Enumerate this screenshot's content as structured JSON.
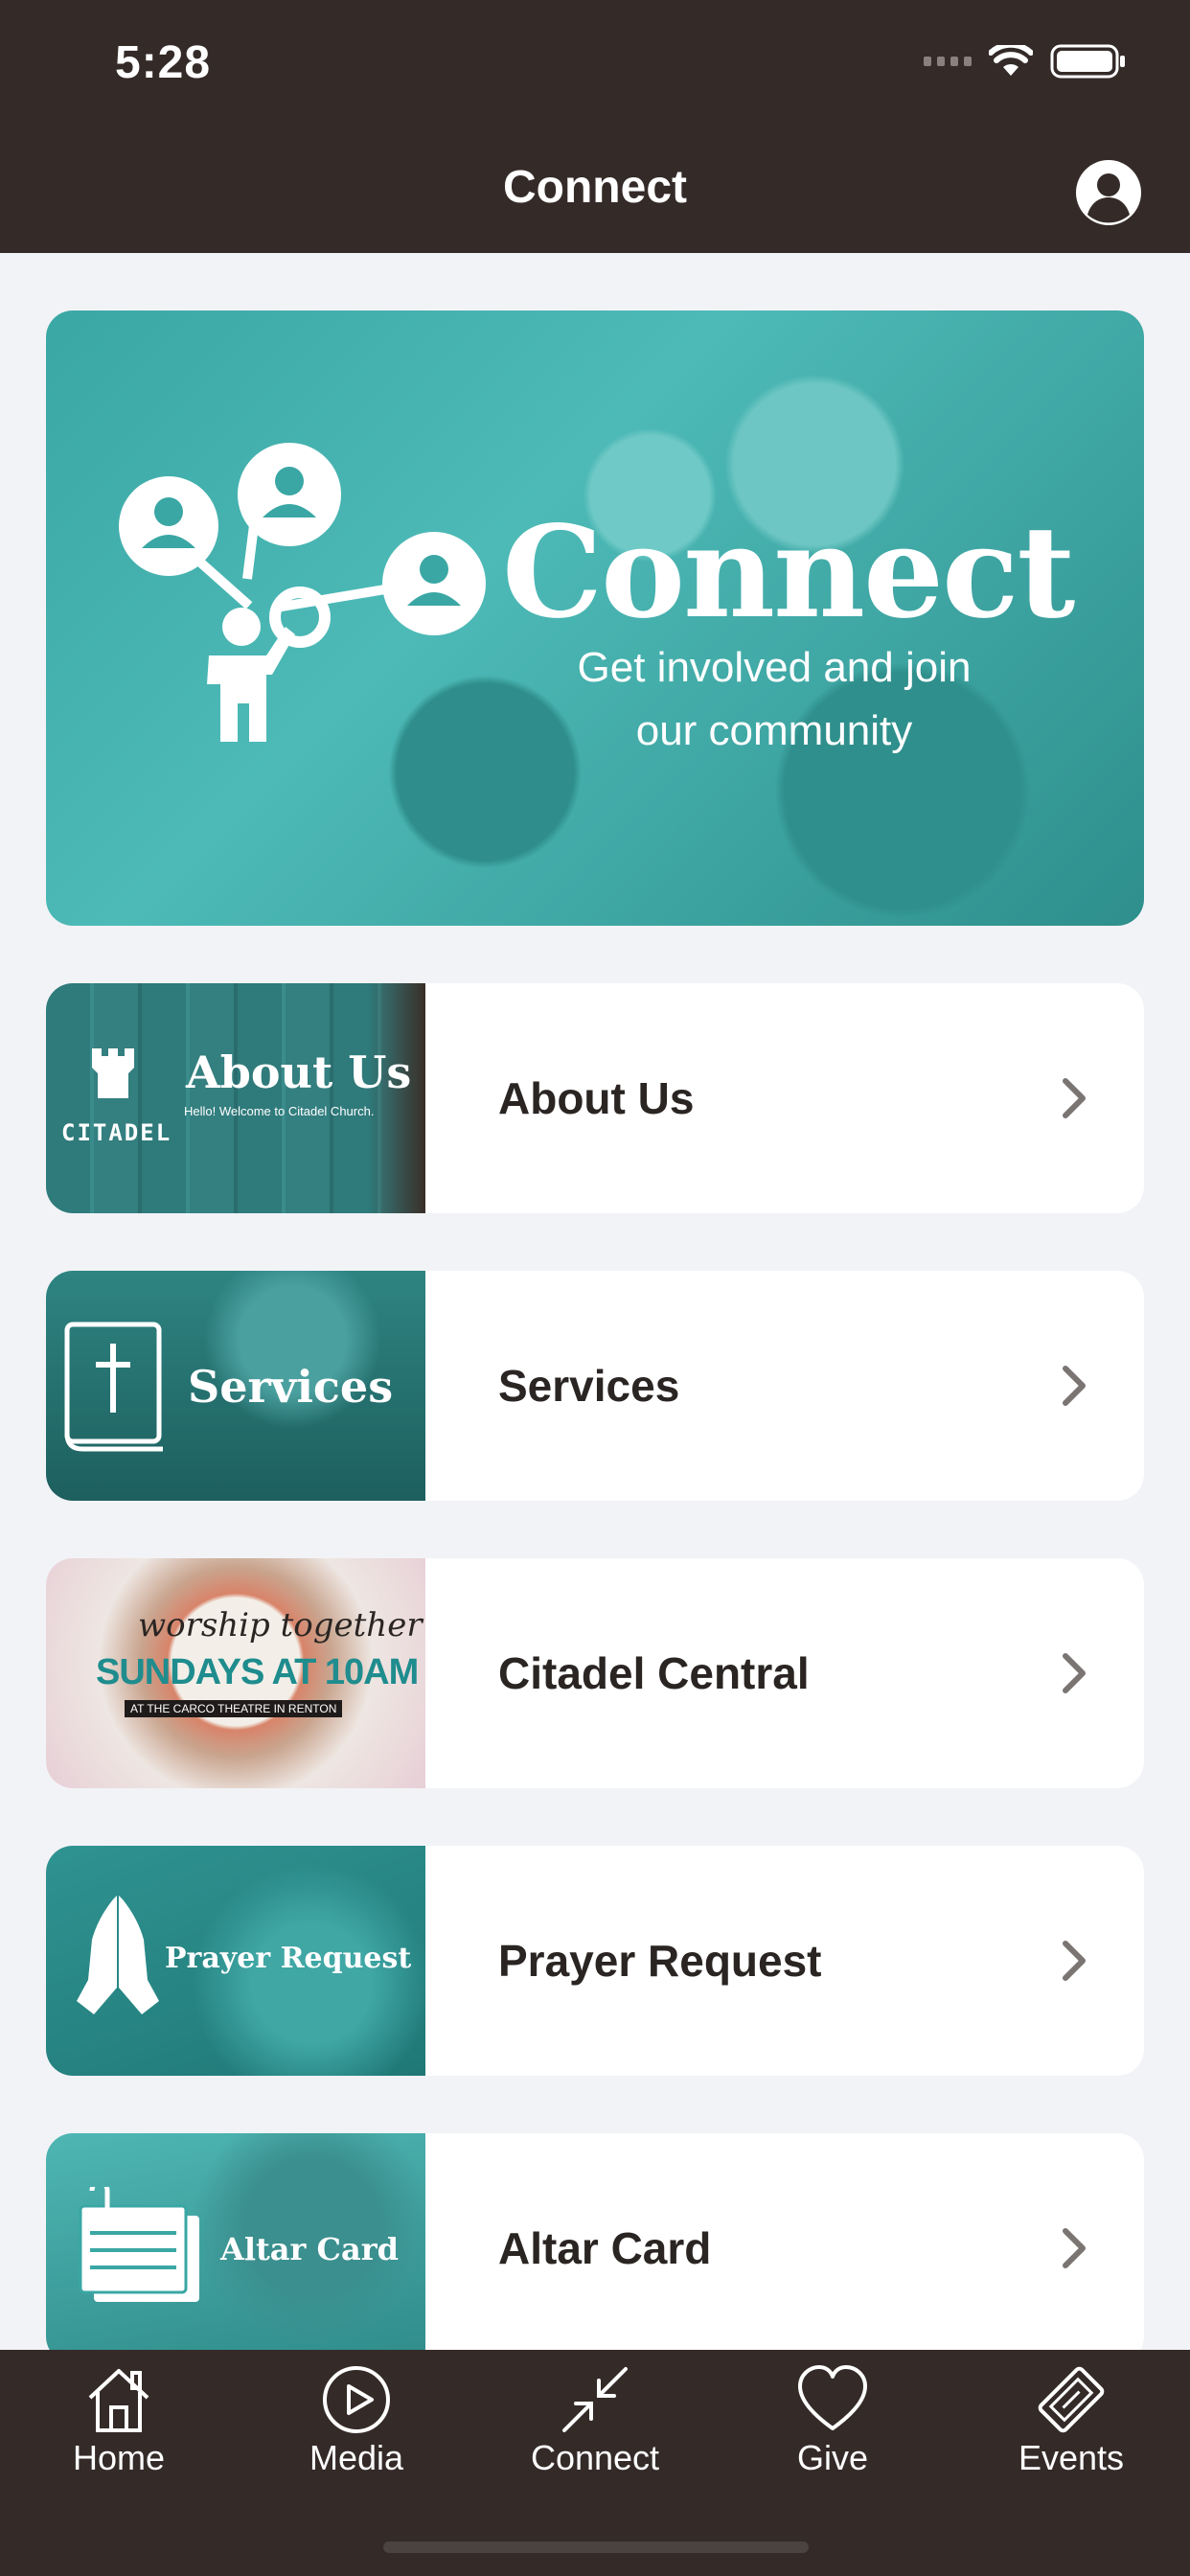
{
  "status_bar": {
    "time": "5:28"
  },
  "nav": {
    "title": "Connect"
  },
  "hero": {
    "title": "Connect",
    "subtitle_line1": "Get involved and  join",
    "subtitle_line2": "our community"
  },
  "cards": [
    {
      "label": "About Us",
      "thumb_title": "About Us",
      "thumb_sub": "Hello! Welcome to Citadel Church.",
      "thumb_brand": "CITADEL"
    },
    {
      "label": "Services",
      "thumb_title": "Services"
    },
    {
      "label": "Citadel Central",
      "thumb_script": "worship together",
      "thumb_title": "SUNDAYS AT 10AM",
      "thumb_sub": "AT THE CARCO THEATRE IN RENTON"
    },
    {
      "label": "Prayer Request",
      "thumb_title": "Prayer Request"
    },
    {
      "label": "Altar Card",
      "thumb_title": "Altar Card"
    }
  ],
  "tabs": [
    {
      "label": "Home",
      "icon": "home-icon"
    },
    {
      "label": "Media",
      "icon": "play-icon"
    },
    {
      "label": "Connect",
      "icon": "connect-icon"
    },
    {
      "label": "Give",
      "icon": "heart-icon"
    },
    {
      "label": "Events",
      "icon": "ticket-icon"
    }
  ],
  "colors": {
    "header_bg": "#342b28",
    "accent_teal": "#3aa7a4",
    "page_bg": "#f2f3f7"
  }
}
